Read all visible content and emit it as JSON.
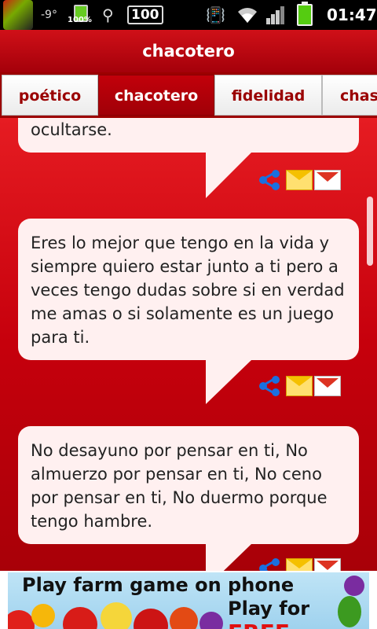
{
  "status_bar": {
    "temperature": "-9°",
    "battery_small_pct": "100%",
    "box_label": "100",
    "time": "01:47"
  },
  "title": "chacotero",
  "tabs": [
    {
      "label": "poético",
      "active": false
    },
    {
      "label": "chacotero",
      "active": true
    },
    {
      "label": "fidelidad",
      "active": false
    },
    {
      "label": "chas",
      "active": false
    }
  ],
  "messages": [
    {
      "text": "ocultarse."
    },
    {
      "text": "Eres lo mejor que tengo en la vida y siempre quiero estar junto a ti pero a veces tengo dudas sobre si en verdad me amas o si solamente es un juego para ti."
    },
    {
      "text": "No desayuno por pensar en ti, No almuerzo por pensar en ti, No ceno por pensar en ti, No duermo porque tengo hambre."
    }
  ],
  "actions": {
    "share_icon": "share-icon",
    "email_icon": "email-icon",
    "gmail_icon": "gmail-icon"
  },
  "ad": {
    "line1": "Play farm game on phone",
    "line2_prefix": "Play for ",
    "line2_highlight": "FREE"
  },
  "colors": {
    "accent": "#c2000a",
    "bubble": "#fff0f0"
  }
}
